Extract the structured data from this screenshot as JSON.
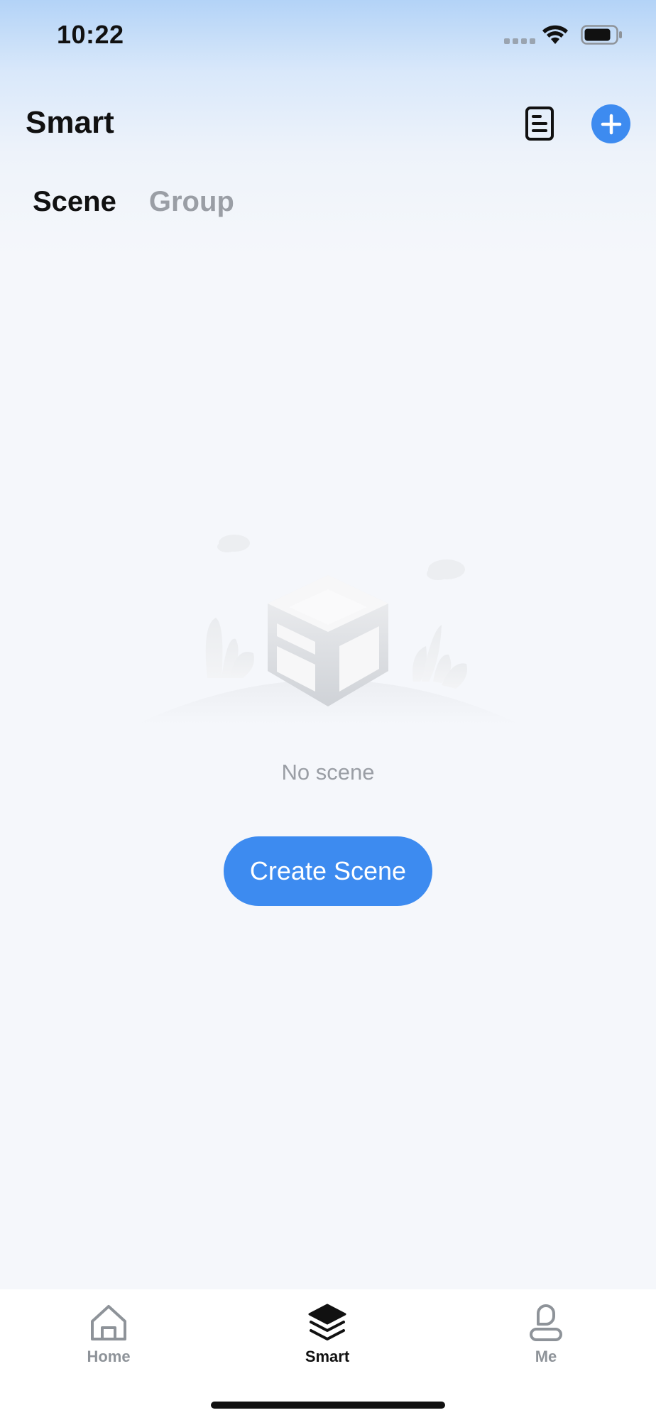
{
  "status_bar": {
    "time": "10:22",
    "signal_icon": "signal-dots-icon",
    "wifi_icon": "wifi-icon",
    "battery_icon": "battery-icon"
  },
  "header": {
    "title": "Smart",
    "doc_icon": "document-icon",
    "add_icon": "plus-icon"
  },
  "tabs": [
    {
      "label": "Scene",
      "active": true
    },
    {
      "label": "Group",
      "active": false
    }
  ],
  "empty_state": {
    "illustration_icon": "empty-box-icon",
    "message": "No scene",
    "action_label": "Create Scene"
  },
  "bottom_nav": {
    "items": [
      {
        "label": "Home",
        "icon": "home-icon",
        "active": false
      },
      {
        "label": "Smart",
        "icon": "layers-icon",
        "active": true
      },
      {
        "label": "Me",
        "icon": "person-icon",
        "active": false
      }
    ]
  },
  "colors": {
    "accent": "#3d8bf0",
    "text_primary": "#111111",
    "text_secondary": "#9a9ea5",
    "background": "#f5f7fb"
  }
}
